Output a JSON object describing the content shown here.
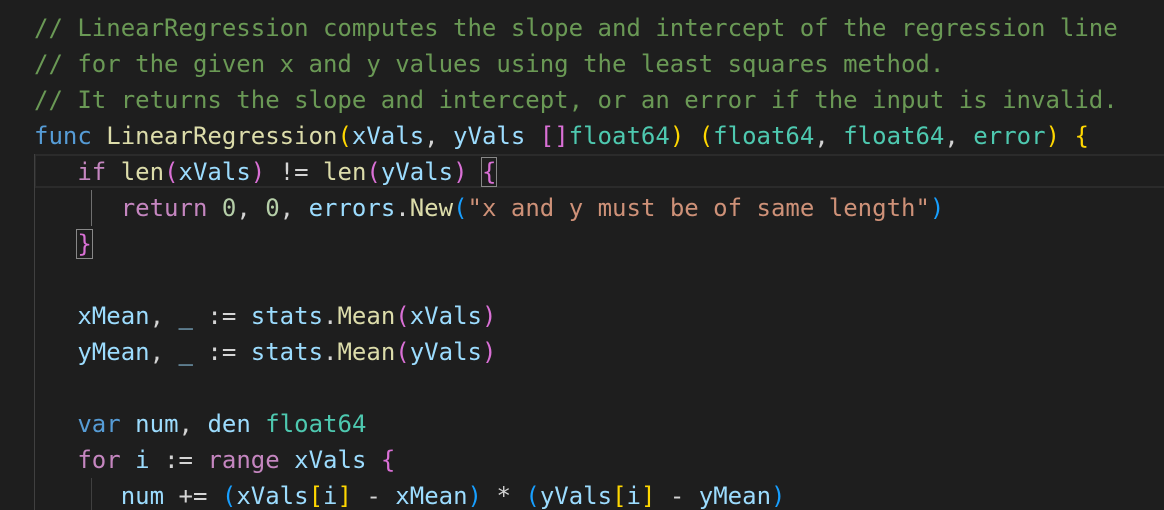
{
  "comments": {
    "line1": "// LinearRegression computes the slope and intercept of the regression line",
    "line2": "// for the given x and y values using the least squares method.",
    "line3": "// It returns the slope and intercept, or an error if the input is invalid."
  },
  "code": {
    "kw_func": "func",
    "func_name": "LinearRegression",
    "param_x": "xVals",
    "param_y": "yVals",
    "type_float64": "float64",
    "type_error": "error",
    "kw_if": "if",
    "fn_len": "len",
    "op_neq": "!=",
    "kw_return": "return",
    "num_zero": "0",
    "pkg_errors": "errors",
    "fn_new": "New",
    "err_msg": "\"x and y must be of same length\"",
    "var_xmean": "xMean",
    "var_ymean": "yMean",
    "blank": "_",
    "op_define": ":=",
    "pkg_stats": "stats",
    "fn_mean": "Mean",
    "kw_var": "var",
    "var_num": "num",
    "var_den": "den",
    "kw_for": "for",
    "var_i": "i",
    "kw_range": "range",
    "op_plus_assign": "+=",
    "op_minus": "-",
    "op_mul": "*"
  },
  "colors": {
    "background": "#1e1e1e",
    "comment": "#6a9955",
    "keyword": "#569cd6",
    "control": "#c586c0",
    "function": "#dcdcaa",
    "variable": "#9cdcfe",
    "type": "#4ec9b0",
    "string": "#ce9178",
    "number": "#b5cea8",
    "bracket_gold": "#ffd700",
    "bracket_orchid": "#da70d6",
    "bracket_blue": "#179fff"
  }
}
